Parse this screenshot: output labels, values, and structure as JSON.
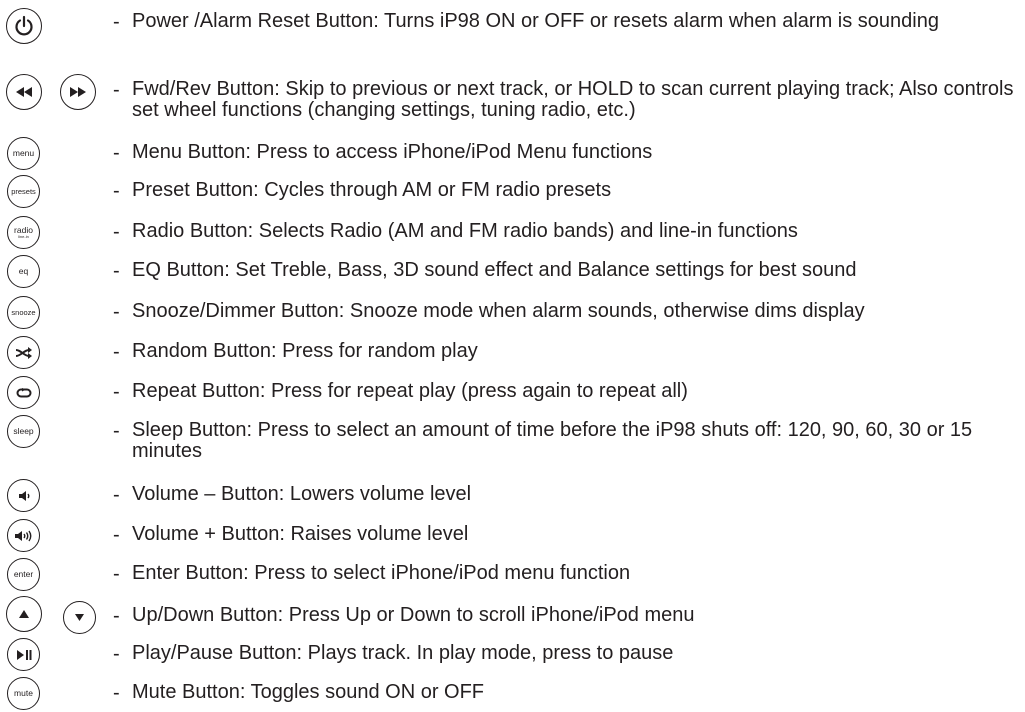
{
  "items": [
    {
      "label": "Power /Alarm Reset Button: Turns iP98 ON or OFF or resets alarm when alarm is sounding",
      "icons": [
        "power-icon"
      ]
    },
    {
      "label": "Fwd/Rev Button: Skip to previous or next track, or HOLD to scan current playing track; Also controls set wheel functions (changing settings, tuning radio, etc.)",
      "icons": [
        "rewind-icon",
        "fast-forward-icon"
      ]
    },
    {
      "label": "Menu Button: Press to access iPhone/iPod Menu functions",
      "icons": [
        "menu-icon"
      ],
      "icon_text": "menu"
    },
    {
      "label": "Preset Button: Cycles through AM or FM radio presets",
      "icons": [
        "presets-icon"
      ],
      "icon_text": "presets"
    },
    {
      "label": "Radio Button: Selects Radio (AM and FM radio bands) and line-in functions",
      "icons": [
        "radio-icon"
      ],
      "icon_text": "radio",
      "icon_subtext": "line-in"
    },
    {
      "label": "EQ Button: Set Treble, Bass, 3D sound effect and Balance settings for best sound",
      "icons": [
        "eq-icon"
      ],
      "icon_text": "eq"
    },
    {
      "label": "Snooze/Dimmer Button: Snooze mode when alarm sounds, otherwise dims display",
      "icons": [
        "snooze-icon"
      ],
      "icon_text": "snooze"
    },
    {
      "label": "Random Button: Press for random play",
      "icons": [
        "shuffle-icon"
      ]
    },
    {
      "label": "Repeat Button: Press for repeat play (press again to repeat all)",
      "icons": [
        "repeat-icon"
      ]
    },
    {
      "label": "Sleep Button: Press to select an amount of time before the iP98 shuts off: 120, 90, 60, 30 or 15 minutes",
      "icons": [
        "sleep-icon"
      ],
      "icon_text": "sleep"
    },
    {
      "label": "Volume – Button: Lowers volume level",
      "icons": [
        "volume-down-icon"
      ]
    },
    {
      "label": "Volume + Button: Raises volume level",
      "icons": [
        "volume-up-icon"
      ]
    },
    {
      "label": "Enter Button: Press to select iPhone/iPod menu function",
      "icons": [
        "enter-icon"
      ],
      "icon_text": "enter"
    },
    {
      "label": "Up/Down Button: Press Up or Down to scroll iPhone/iPod menu",
      "icons": [
        "up-arrow-icon",
        "down-arrow-icon"
      ]
    },
    {
      "label": "Play/Pause Button: Plays track. In play mode, press to pause",
      "icons": [
        "play-pause-icon"
      ]
    },
    {
      "label": "Mute Button: Toggles sound ON or OFF",
      "icons": [
        "mute-icon"
      ],
      "icon_text": "mute"
    }
  ],
  "dash": "-"
}
